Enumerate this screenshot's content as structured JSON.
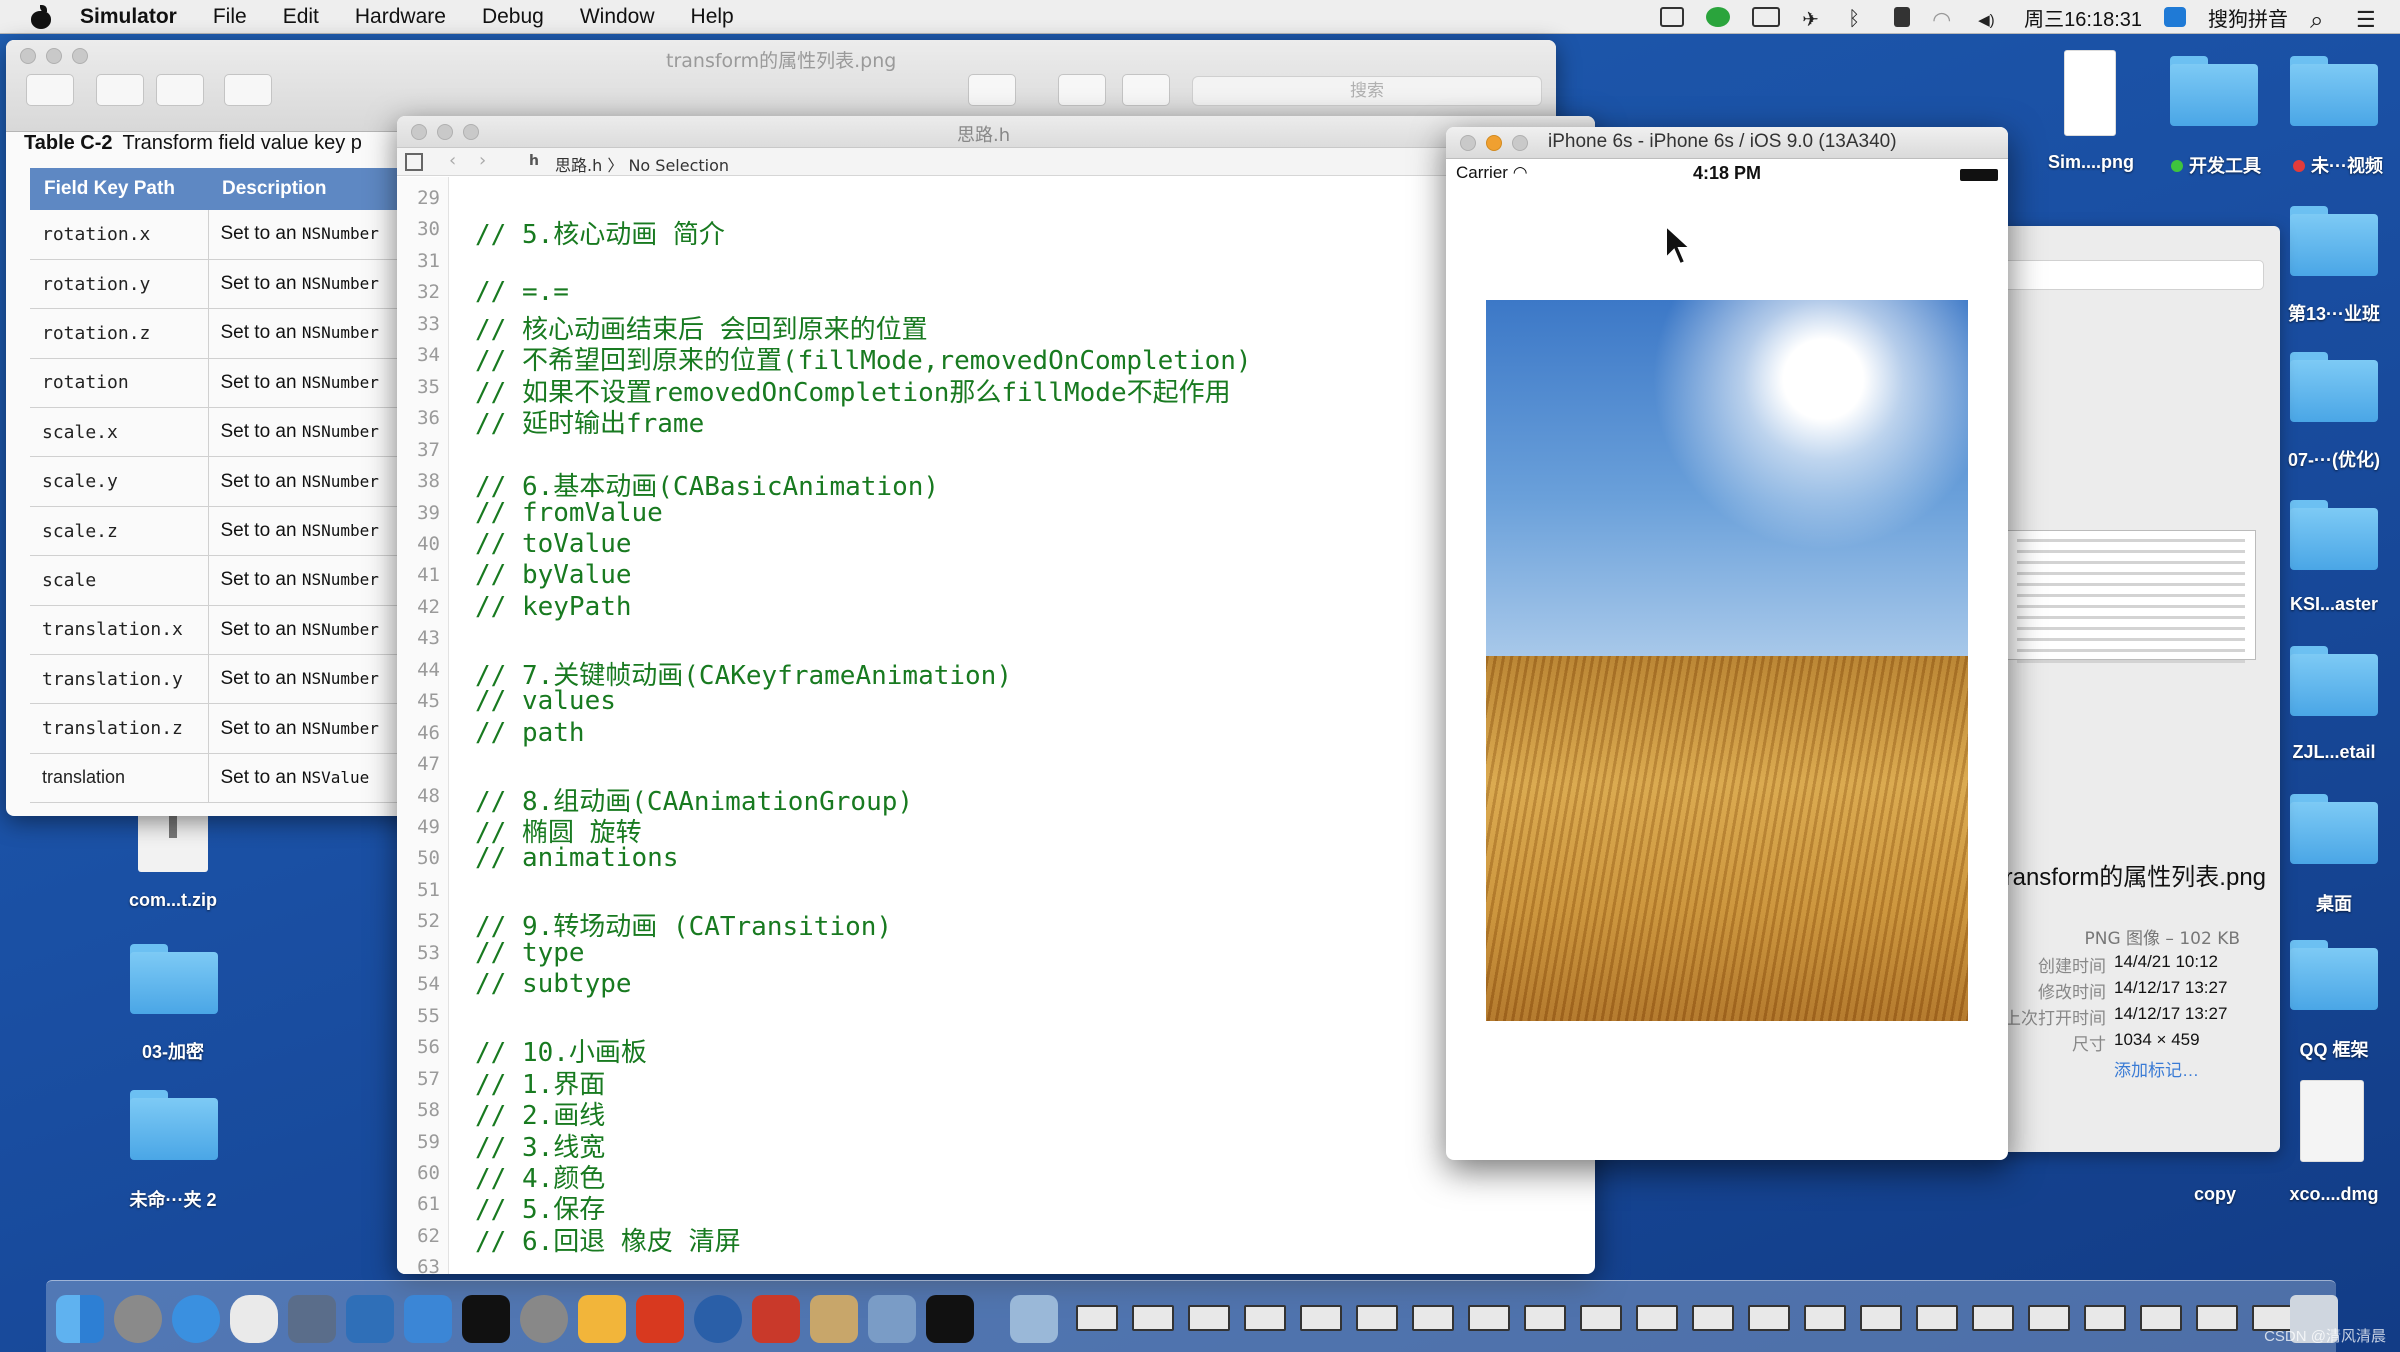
{
  "menubar": {
    "app_name": "Simulator",
    "items": [
      "File",
      "Edit",
      "Hardware",
      "Debug",
      "Window",
      "Help"
    ],
    "clock": "周三16:18:31",
    "ime": "搜狗拼音",
    "status_icons": [
      "screen-mirror-icon",
      "green-app-icon",
      "camera-icon",
      "airplane-icon",
      "bluetooth-icon",
      "lock-icon",
      "wifi-icon",
      "volume-icon"
    ]
  },
  "preview": {
    "title": "transform的属性列表.png",
    "search_placeholder": "搜索",
    "table_caption_label": "Table C-2",
    "table_caption_text": "Transform field value key p",
    "columns": [
      "Field Key Path",
      "Description"
    ],
    "rows": [
      {
        "key": "rotation.x",
        "desc": "Set to an ",
        "type": "NSNumber"
      },
      {
        "key": "rotation.y",
        "desc": "Set to an ",
        "type": "NSNumber"
      },
      {
        "key": "rotation.z",
        "desc": "Set to an ",
        "type": "NSNumber"
      },
      {
        "key": "rotation",
        "desc": "Set to an ",
        "type": "NSNumber"
      },
      {
        "key": "scale.x",
        "desc": "Set to an ",
        "type": "NSNumber"
      },
      {
        "key": "scale.y",
        "desc": "Set to an ",
        "type": "NSNumber"
      },
      {
        "key": "scale.z",
        "desc": "Set to an ",
        "type": "NSNumber"
      },
      {
        "key": "scale",
        "desc": "Set to an ",
        "type": "NSNumber"
      },
      {
        "key": "translation.x",
        "desc": "Set to an ",
        "type": "NSNumber"
      },
      {
        "key": "translation.y",
        "desc": "Set to an ",
        "type": "NSNumber"
      },
      {
        "key": "translation.z",
        "desc": "Set to an ",
        "type": "NSNumber"
      },
      {
        "key": "translation",
        "desc": "Set to an ",
        "type": "NSValue"
      }
    ]
  },
  "editor": {
    "title": "思路.h",
    "breadcrumb_file": "思路.h",
    "breadcrumb_sep": "〉",
    "breadcrumb_sel": "No Selection",
    "lines": [
      {
        "n": "29",
        "t": ""
      },
      {
        "n": "30",
        "t": "// 5.核心动画 简介"
      },
      {
        "n": "31",
        "t": ""
      },
      {
        "n": "32",
        "t": "// =.="
      },
      {
        "n": "33",
        "t": "// 核心动画结束后 会回到原来的位置"
      },
      {
        "n": "34",
        "t": "// 不希望回到原来的位置(fillMode,removedOnCompletion)"
      },
      {
        "n": "35",
        "t": "// 如果不设置removedOnCompletion那么fillMode不起作用"
      },
      {
        "n": "36",
        "t": "// 延时输出frame"
      },
      {
        "n": "37",
        "t": ""
      },
      {
        "n": "38",
        "t": "// 6.基本动画(CABasicAnimation)"
      },
      {
        "n": "39",
        "t": "// fromValue"
      },
      {
        "n": "40",
        "t": "// toValue"
      },
      {
        "n": "41",
        "t": "// byValue"
      },
      {
        "n": "42",
        "t": "// keyPath"
      },
      {
        "n": "43",
        "t": ""
      },
      {
        "n": "44",
        "t": "// 7.关键帧动画(CAKeyframeAnimation)"
      },
      {
        "n": "45",
        "t": "// values"
      },
      {
        "n": "46",
        "t": "// path"
      },
      {
        "n": "47",
        "t": ""
      },
      {
        "n": "48",
        "t": "// 8.组动画(CAAnimationGroup)"
      },
      {
        "n": "49",
        "t": "// 椭圆 旋转"
      },
      {
        "n": "50",
        "t": "// animations"
      },
      {
        "n": "51",
        "t": ""
      },
      {
        "n": "52",
        "t": "// 9.转场动画 (CATransition)"
      },
      {
        "n": "53",
        "t": "// type"
      },
      {
        "n": "54",
        "t": "// subtype"
      },
      {
        "n": "55",
        "t": ""
      },
      {
        "n": "56",
        "t": "// 10.小画板"
      },
      {
        "n": "57",
        "t": "// 1.界面"
      },
      {
        "n": "58",
        "t": "// 2.画线"
      },
      {
        "n": "59",
        "t": "// 3.线宽"
      },
      {
        "n": "60",
        "t": "// 4.颜色"
      },
      {
        "n": "61",
        "t": "// 5.保存"
      },
      {
        "n": "62",
        "t": "// 6.回退 橡皮 清屏"
      },
      {
        "n": "63",
        "t": ""
      }
    ]
  },
  "simulator": {
    "title": "iPhone 6s - iPhone 6s / iOS 9.0 (13A340)",
    "carrier": "Carrier",
    "time": "4:18 PM"
  },
  "info_panel": {
    "filename": "transform的属性列表.png",
    "kind": "PNG 图像 – 102 KB",
    "rows": [
      {
        "label": "创建时间",
        "value": "14/4/21 10:12"
      },
      {
        "label": "修改时间",
        "value": "14/12/17 13:27"
      },
      {
        "label": "上次打开时间",
        "value": "14/12/17 13:27"
      },
      {
        "label": "尺寸",
        "value": "1034 × 459"
      }
    ],
    "add_tag": "添加标记…"
  },
  "desktop": {
    "icons": [
      {
        "label": "Sim....png"
      },
      {
        "label": "开发工具",
        "dot": "#3ec43e"
      },
      {
        "label": "未···视频",
        "dot": "#e23b3b"
      },
      {
        "label": "第13···业班"
      },
      {
        "label": "07-···(优化)"
      },
      {
        "label": "KSI...aster"
      },
      {
        "label": "ZJL...etail"
      },
      {
        "label": "桌面"
      },
      {
        "label": "QQ 框架"
      },
      {
        "label": "copy"
      },
      {
        "label": "xco....dmg"
      },
      {
        "label": "com...t.zip"
      },
      {
        "label": "03-加密"
      },
      {
        "label": "未命···夹 2"
      }
    ]
  },
  "watermark": "CSDN @清风清晨"
}
